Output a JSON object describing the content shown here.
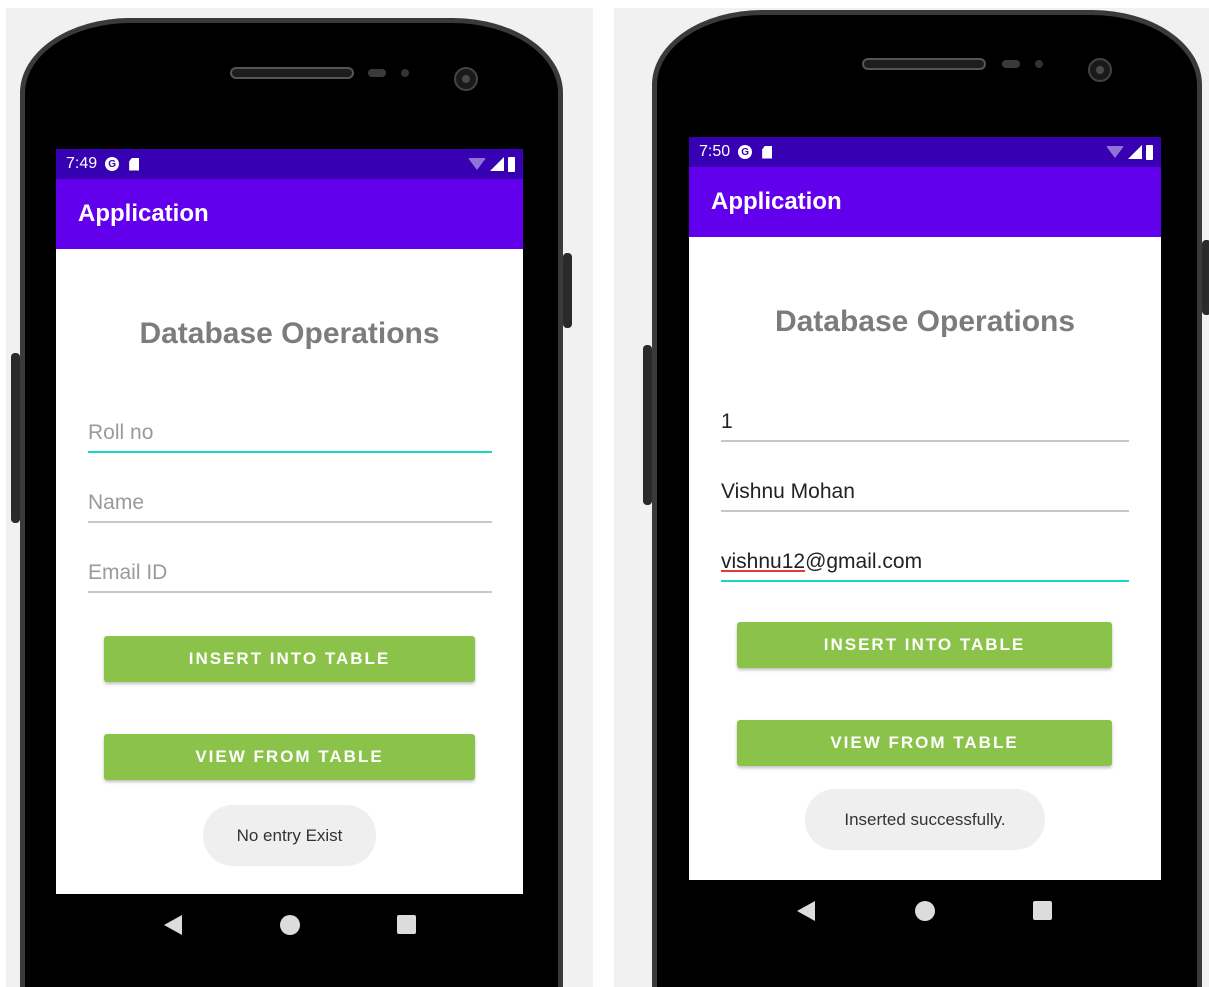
{
  "screens": [
    {
      "status_time": "7:49",
      "app_title": "Application",
      "heading": "Database Operations",
      "fields": {
        "roll_no": {
          "value": "",
          "placeholder": "Roll no"
        },
        "name": {
          "value": "",
          "placeholder": "Name"
        },
        "email": {
          "value": "",
          "placeholder": "Email ID"
        }
      },
      "insert_label": "INSERT INTO TABLE",
      "view_label": "VIEW FROM TABLE",
      "toast": "No entry Exist"
    },
    {
      "status_time": "7:50",
      "app_title": "Application",
      "heading": "Database Operations",
      "fields": {
        "roll_no": {
          "value": "1",
          "placeholder": ""
        },
        "name": {
          "value": "Vishnu Mohan",
          "placeholder": ""
        },
        "email": {
          "value_misspelled": "vishnu12",
          "value_rest": "@gmail.com",
          "placeholder": ""
        }
      },
      "insert_label": "INSERT INTO TABLE",
      "view_label": "VIEW FROM TABLE",
      "toast": "Inserted successfully."
    }
  ],
  "icons": {
    "status_left": [
      "data-saver-icon",
      "sd-card-icon"
    ],
    "status_right": [
      "wifi-icon",
      "cell-signal-icon",
      "battery-icon"
    ],
    "nav": [
      "back-icon",
      "home-icon",
      "recents-icon"
    ]
  },
  "colors": {
    "status_bar": "#3700b3",
    "app_bar": "#6200ee",
    "button": "#8bc34a",
    "focus_underline": "#16d6c6",
    "heading": "#7c7c7c"
  }
}
